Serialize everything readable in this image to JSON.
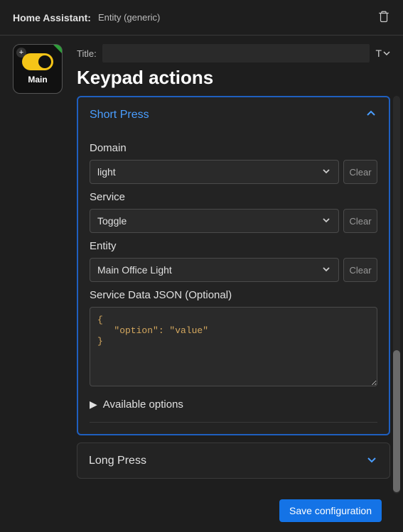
{
  "header": {
    "app_label": "Home Assistant:",
    "entity_label": "Entity (generic)"
  },
  "thumbnail": {
    "label": "Main"
  },
  "title_row": {
    "label": "Title:",
    "value": "",
    "t_label": "T"
  },
  "page_title": "Keypad actions",
  "short_press": {
    "title": "Short Press",
    "domain_label": "Domain",
    "domain_value": "light",
    "service_label": "Service",
    "service_value": "Toggle",
    "entity_label": "Entity",
    "entity_value": "Main Office Light",
    "json_label": "Service Data JSON (Optional)",
    "json_value": "{\n   \"option\": \"value\"\n}",
    "available_label": "Available options",
    "clear_label": "Clear"
  },
  "long_press": {
    "title": "Long Press"
  },
  "save_button": "Save configuration"
}
